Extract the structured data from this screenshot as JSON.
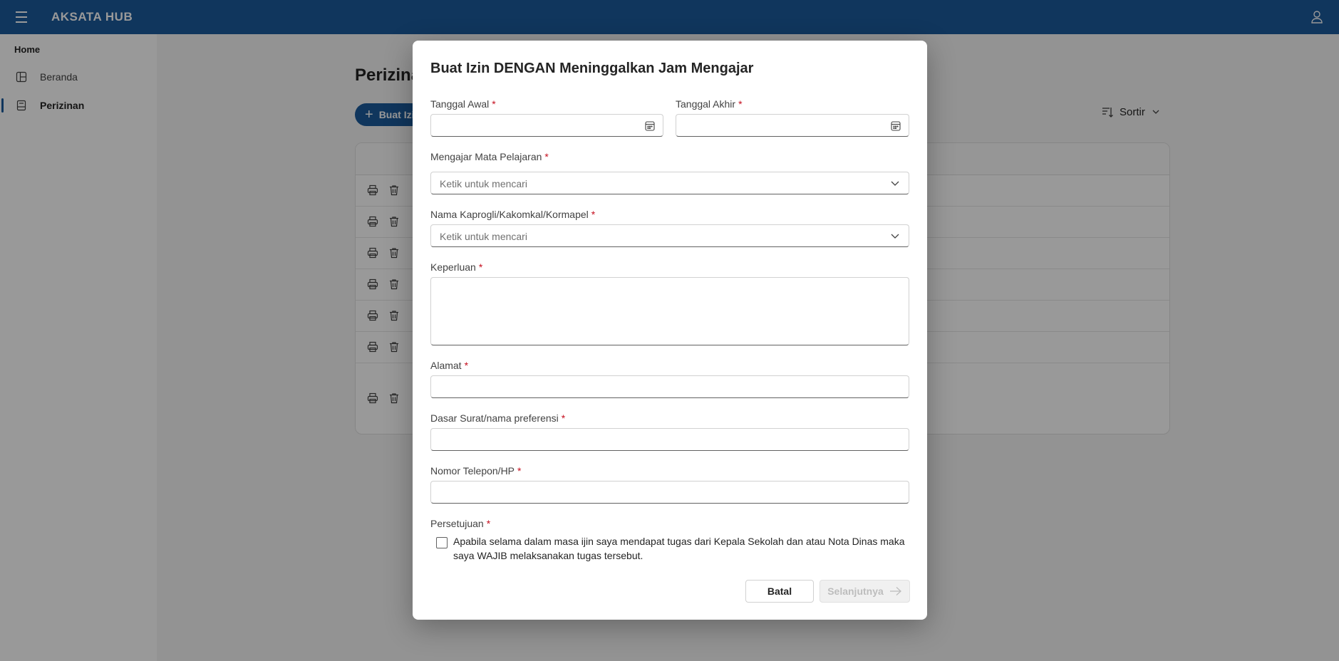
{
  "app": {
    "brand": "AKSATA HUB"
  },
  "sidebar": {
    "home_label": "Home",
    "items": [
      {
        "label": "Beranda",
        "icon": "grid-icon",
        "active": false
      },
      {
        "label": "Perizinan",
        "icon": "document-icon",
        "active": true
      }
    ]
  },
  "main": {
    "title": "Perizinan",
    "add_button_label": "Buat Izin",
    "sort_label": "Sortir",
    "row_count": 7
  },
  "dialog": {
    "title": "Buat Izin DENGAN Meninggalkan Jam Mengajar",
    "required_marker": "*",
    "fields": {
      "start_date_label": "Tanggal Awal",
      "start_date_value": "",
      "end_date_label": "Tanggal Akhir",
      "end_date_value": "",
      "subject_label": "Mengajar Mata Pelajaran",
      "subject_placeholder": "Ketik untuk mencari",
      "head_label": "Nama Kaprogli/Kakomkal/Kormapel",
      "head_placeholder": "Ketik untuk mencari",
      "purpose_label": "Keperluan",
      "purpose_value": "",
      "address_label": "Alamat",
      "address_value": "",
      "basis_label": "Dasar Surat/nama preferensi",
      "basis_value": "",
      "phone_label": "Nomor Telepon/HP",
      "phone_value": "",
      "consent_label": "Persetujuan",
      "consent_text": "Apabila selama dalam masa ijin saya mendapat tugas dari Kepala Sekolah dan atau Nota Dinas maka saya WAJIB melaksanakan tugas tersebut.",
      "consent_checked": false
    },
    "buttons": {
      "cancel_label": "Batal",
      "next_label": "Selanjutnya",
      "next_disabled": true
    }
  },
  "colors": {
    "topbar": "#1c5a9c",
    "primary": "#1c5a9c",
    "required": "#c50f1f"
  }
}
